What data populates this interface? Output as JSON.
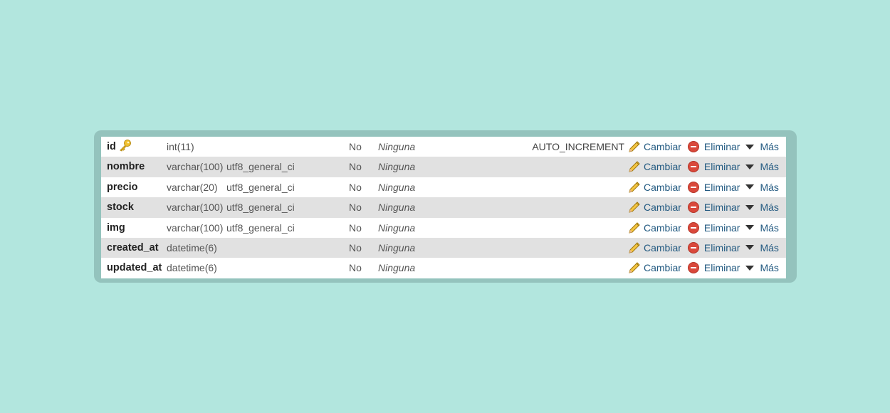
{
  "rows": [
    {
      "name": "id",
      "type": "int(11)",
      "collation": "",
      "null": "No",
      "default": "Ninguna",
      "extra": "AUTO_INCREMENT",
      "primary_key": true
    },
    {
      "name": "nombre",
      "type": "varchar(100)",
      "collation": "utf8_general_ci",
      "null": "No",
      "default": "Ninguna",
      "extra": ""
    },
    {
      "name": "precio",
      "type": "varchar(20)",
      "collation": "utf8_general_ci",
      "null": "No",
      "default": "Ninguna",
      "extra": ""
    },
    {
      "name": "stock",
      "type": "varchar(100)",
      "collation": "utf8_general_ci",
      "null": "No",
      "default": "Ninguna",
      "extra": ""
    },
    {
      "name": "img",
      "type": "varchar(100)",
      "collation": "utf8_general_ci",
      "null": "No",
      "default": "Ninguna",
      "extra": ""
    },
    {
      "name": "created_at",
      "type": "datetime(6)",
      "collation": "",
      "null": "No",
      "default": "Ninguna",
      "extra": ""
    },
    {
      "name": "updated_at",
      "type": "datetime(6)",
      "collation": "",
      "null": "No",
      "default": "Ninguna",
      "extra": ""
    }
  ],
  "actions": {
    "change": "Cambiar",
    "drop": "Eliminar",
    "more": "Más"
  },
  "colors": {
    "background": "#b2e6de",
    "frame": "#94c3bd",
    "link": "#235a81"
  }
}
